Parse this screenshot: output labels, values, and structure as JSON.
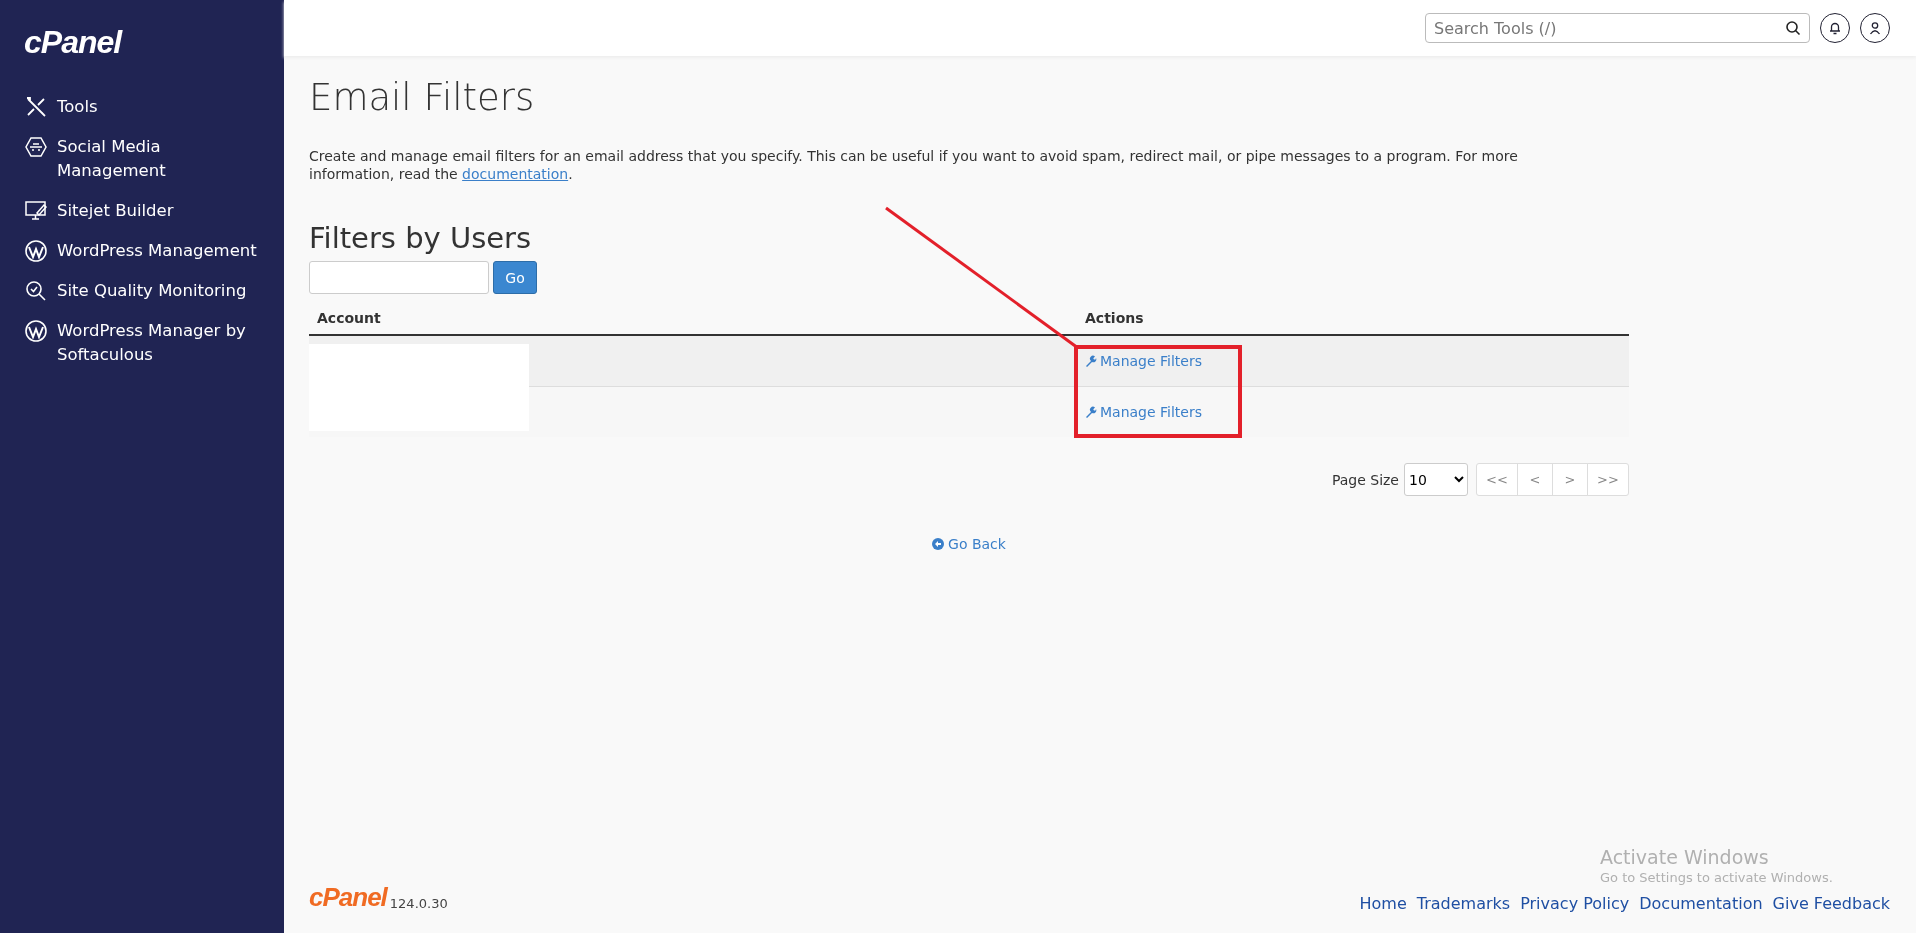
{
  "sidebar": {
    "logo": "cPanel",
    "items": [
      {
        "kind": "tools",
        "label": "Tools"
      },
      {
        "kind": "social",
        "label": "Social Media Management"
      },
      {
        "kind": "sitejet",
        "label": "Sitejet Builder"
      },
      {
        "kind": "wordpress",
        "label": "WordPress Management"
      },
      {
        "kind": "quality",
        "label": "Site Quality Monitoring"
      },
      {
        "kind": "wordpress",
        "label": "WordPress Manager by Softaculous"
      }
    ]
  },
  "header": {
    "search": {
      "placeholder": "Search Tools (/)"
    }
  },
  "page": {
    "title": "Email Filters",
    "description": {
      "text": "Create and manage email filters for an email address that you specify. This can be useful if you want to avoid spam, redirect mail, or pipe messages to a program. For more information, read the ",
      "link": "documentation",
      "after": "."
    }
  },
  "filters": {
    "heading": "Filters by Users",
    "go_button": "Go",
    "columns": [
      "Account",
      "Actions"
    ],
    "rows": [
      {
        "action": "Manage Filters"
      },
      {
        "action": "Manage Filters"
      }
    ],
    "pagination": {
      "label": "Page Size",
      "page_size": "10",
      "buttons": [
        "<<",
        "<",
        ">",
        ">>"
      ]
    }
  },
  "go_back": "Go Back",
  "footer": {
    "logo": "cPanel",
    "version": "124.0.30",
    "links": [
      "Home",
      "Trademarks",
      "Privacy Policy",
      "Documentation",
      "Give Feedback"
    ]
  },
  "os_notice": {
    "title": "Activate Windows",
    "subtitle": "Go to Settings to activate Windows."
  }
}
